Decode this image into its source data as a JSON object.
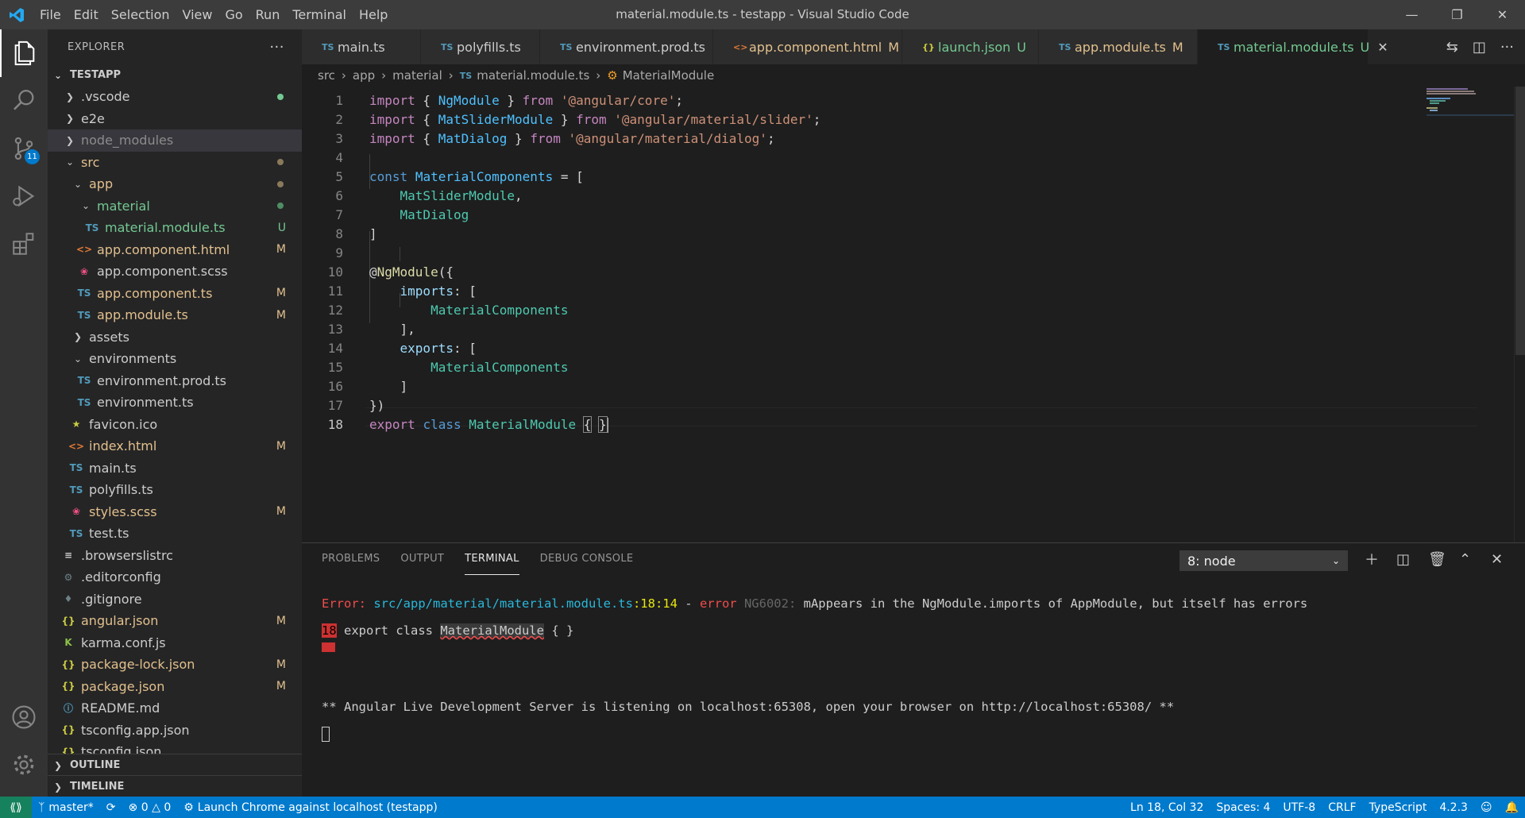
{
  "window": {
    "title": "material.module.ts - testapp - Visual Studio Code",
    "menu": [
      "File",
      "Edit",
      "Selection",
      "View",
      "Go",
      "Run",
      "Terminal",
      "Help"
    ]
  },
  "activity_bar": {
    "scm_badge": "11"
  },
  "sidebar": {
    "title": "EXPLORER",
    "root": "TESTAPP",
    "items": [
      {
        "label": ".vscode",
        "status": ""
      },
      {
        "label": "e2e",
        "status": ""
      },
      {
        "label": "node_modules",
        "status": ""
      },
      {
        "label": "src",
        "status": ""
      },
      {
        "label": "app",
        "status": ""
      },
      {
        "label": "material",
        "status": ""
      },
      {
        "label": "material.module.ts",
        "status": "U"
      },
      {
        "label": "app.component.html",
        "status": "M"
      },
      {
        "label": "app.component.scss",
        "status": ""
      },
      {
        "label": "app.component.ts",
        "status": "M"
      },
      {
        "label": "app.module.ts",
        "status": "M"
      },
      {
        "label": "assets",
        "status": ""
      },
      {
        "label": "environments",
        "status": ""
      },
      {
        "label": "environment.prod.ts",
        "status": ""
      },
      {
        "label": "environment.ts",
        "status": ""
      },
      {
        "label": "favicon.ico",
        "status": ""
      },
      {
        "label": "index.html",
        "status": "M"
      },
      {
        "label": "main.ts",
        "status": ""
      },
      {
        "label": "polyfills.ts",
        "status": ""
      },
      {
        "label": "styles.scss",
        "status": "M"
      },
      {
        "label": "test.ts",
        "status": ""
      },
      {
        "label": ".browserslistrc",
        "status": ""
      },
      {
        "label": ".editorconfig",
        "status": ""
      },
      {
        "label": ".gitignore",
        "status": ""
      },
      {
        "label": "angular.json",
        "status": "M"
      },
      {
        "label": "karma.conf.js",
        "status": ""
      },
      {
        "label": "package-lock.json",
        "status": "M"
      },
      {
        "label": "package.json",
        "status": "M"
      },
      {
        "label": "README.md",
        "status": ""
      },
      {
        "label": "tsconfig.app.json",
        "status": ""
      },
      {
        "label": "tsconfig.json",
        "status": ""
      }
    ],
    "outline": "OUTLINE",
    "timeline": "TIMELINE"
  },
  "tabs": [
    {
      "icon": "TS",
      "label": "main.ts",
      "status": ""
    },
    {
      "icon": "TS",
      "label": "polyfills.ts",
      "status": ""
    },
    {
      "icon": "TS",
      "label": "environment.prod.ts",
      "status": ""
    },
    {
      "icon": "<>",
      "label": "app.component.html",
      "status": "M"
    },
    {
      "icon": "{}",
      "label": "launch.json",
      "status": "U"
    },
    {
      "icon": "TS",
      "label": "app.module.ts",
      "status": "M"
    },
    {
      "icon": "TS",
      "label": "material.module.ts",
      "status": "U"
    }
  ],
  "breadcrumb": [
    "src",
    "app",
    "material",
    "material.module.ts",
    "MaterialModule"
  ],
  "editor": {
    "line_numbers": [
      "1",
      "2",
      "3",
      "4",
      "5",
      "6",
      "7",
      "8",
      "9",
      "10",
      "11",
      "12",
      "13",
      "14",
      "15",
      "16",
      "17",
      "18"
    ],
    "lines": [
      [
        {
          "t": "import",
          "c": "kw2"
        },
        {
          "t": " { ",
          "c": "pun"
        },
        {
          "t": "NgModule",
          "c": "var"
        },
        {
          "t": " } ",
          "c": "pun"
        },
        {
          "t": "from",
          "c": "kw2"
        },
        {
          "t": " ",
          "c": "pun"
        },
        {
          "t": "'@angular/core'",
          "c": "str"
        },
        {
          "t": ";",
          "c": "pun"
        }
      ],
      [
        {
          "t": "import",
          "c": "kw2"
        },
        {
          "t": " { ",
          "c": "pun"
        },
        {
          "t": "MatSliderModule",
          "c": "var"
        },
        {
          "t": " } ",
          "c": "pun"
        },
        {
          "t": "from",
          "c": "kw2"
        },
        {
          "t": " ",
          "c": "pun"
        },
        {
          "t": "'@angular/material/slider'",
          "c": "str"
        },
        {
          "t": ";",
          "c": "pun"
        }
      ],
      [
        {
          "t": "import",
          "c": "kw2"
        },
        {
          "t": " { ",
          "c": "pun"
        },
        {
          "t": "MatDialog",
          "c": "var"
        },
        {
          "t": " } ",
          "c": "pun"
        },
        {
          "t": "from",
          "c": "kw2"
        },
        {
          "t": " ",
          "c": "pun"
        },
        {
          "t": "'@angular/material/dialog'",
          "c": "str"
        },
        {
          "t": ";",
          "c": "pun"
        }
      ],
      [],
      [
        {
          "t": "const",
          "c": "kw"
        },
        {
          "t": " ",
          "c": "pun"
        },
        {
          "t": "MaterialComponents",
          "c": "var"
        },
        {
          "t": " = [",
          "c": "pun"
        }
      ],
      [
        {
          "t": "    ",
          "c": "pun"
        },
        {
          "t": "MatSliderModule",
          "c": "cls"
        },
        {
          "t": ",",
          "c": "pun"
        }
      ],
      [
        {
          "t": "    ",
          "c": "pun"
        },
        {
          "t": "MatDialog",
          "c": "cls"
        }
      ],
      [
        {
          "t": "]",
          "c": "pun"
        }
      ],
      [],
      [
        {
          "t": "@",
          "c": "pun"
        },
        {
          "t": "NgModule",
          "c": "dec"
        },
        {
          "t": "({",
          "c": "pun"
        }
      ],
      [
        {
          "t": "    ",
          "c": "pun"
        },
        {
          "t": "imports",
          "c": "prop"
        },
        {
          "t": ": [",
          "c": "pun"
        }
      ],
      [
        {
          "t": "        ",
          "c": "pun"
        },
        {
          "t": "MaterialComponents",
          "c": "cls"
        }
      ],
      [
        {
          "t": "    ],",
          "c": "pun"
        }
      ],
      [
        {
          "t": "    ",
          "c": "pun"
        },
        {
          "t": "exports",
          "c": "prop"
        },
        {
          "t": ": [",
          "c": "pun"
        }
      ],
      [
        {
          "t": "        ",
          "c": "pun"
        },
        {
          "t": "MaterialComponents",
          "c": "cls"
        }
      ],
      [
        {
          "t": "    ]",
          "c": "pun"
        }
      ],
      [
        {
          "t": "})",
          "c": "pun"
        }
      ],
      [
        {
          "t": "export",
          "c": "kw2"
        },
        {
          "t": " ",
          "c": "pun"
        },
        {
          "t": "class",
          "c": "kw"
        },
        {
          "t": " ",
          "c": "pun"
        },
        {
          "t": "MaterialModule",
          "c": "cls"
        },
        {
          "t": " ",
          "c": "pun"
        },
        {
          "t": "{",
          "c": "pun brk"
        },
        {
          "t": " ",
          "c": "pun"
        },
        {
          "t": "}",
          "c": "pun brk"
        }
      ]
    ]
  },
  "panel": {
    "tabs": [
      "PROBLEMS",
      "OUTPUT",
      "TERMINAL",
      "DEBUG CONSOLE"
    ],
    "active_tab": "TERMINAL",
    "terminal_select": "8: node",
    "error_prefix": "Error:",
    "error_path": "src/app/material/material.module.ts",
    "error_pos": ":18:14",
    "error_dash": " - ",
    "error_word": "error",
    "error_code": " NG6002: ",
    "error_msg": "mAppears in the NgModule.imports of AppModule, but itself has errors",
    "snippet_lineno": "18",
    "snippet_before": " export class ",
    "snippet_highlight": "MaterialModule",
    "snippet_after": " { }",
    "server_msg": "** Angular Live Development Server is listening on localhost:65308, open your browser on http://localhost:65308/ **"
  },
  "statusbar": {
    "branch": "master*",
    "errors": "0",
    "warnings": "0",
    "launch": "Launch Chrome against localhost (testapp)",
    "position": "Ln 18, Col 32",
    "spaces": "Spaces: 4",
    "encoding": "UTF-8",
    "eol": "CRLF",
    "language": "TypeScript",
    "ts_version": "4.2.3"
  },
  "colors": {
    "accent": "#007acc",
    "modified": "#e2c08d",
    "untracked": "#73c991",
    "error": "#f14c4c"
  }
}
